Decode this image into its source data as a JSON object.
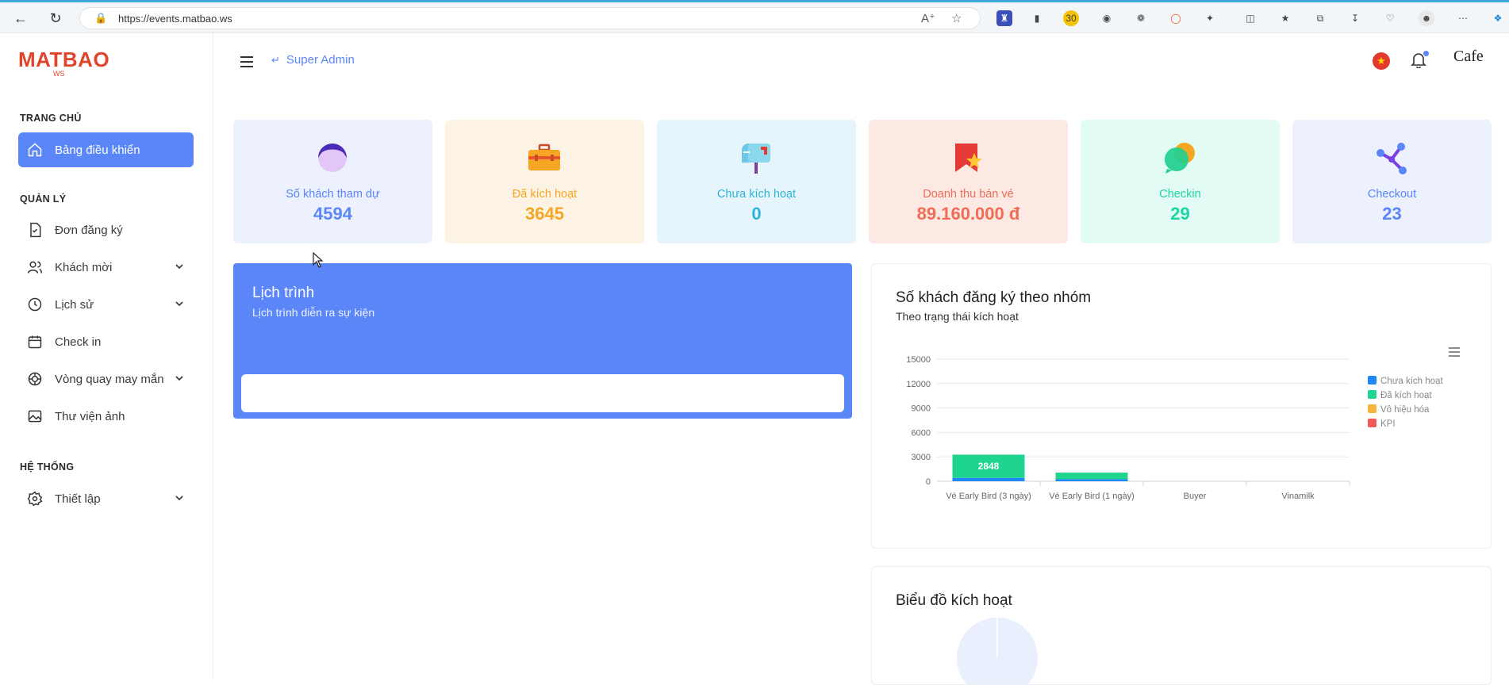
{
  "browser": {
    "url": "https://events.matbao.ws"
  },
  "sidebar": {
    "logo_main": "MATBAO",
    "logo_sub": "WS",
    "sections": [
      {
        "label": "TRANG CHỦ"
      },
      {
        "label": "QUẢN LÝ"
      },
      {
        "label": "HỆ THỐNG"
      }
    ],
    "items": [
      {
        "label": "Bảng điều khiển",
        "icon": "home-icon",
        "active": true
      },
      {
        "label": "Đơn đăng ký",
        "icon": "document-icon"
      },
      {
        "label": "Khách mời",
        "icon": "users-icon"
      },
      {
        "label": "Lịch sử",
        "icon": "clock-icon"
      },
      {
        "label": "Check in",
        "icon": "calendar-icon"
      },
      {
        "label": "Vòng quay may mắn",
        "icon": "wheel-icon"
      },
      {
        "label": "Thư viện ảnh",
        "icon": "image-icon"
      },
      {
        "label": "Thiết lập",
        "icon": "gear-icon"
      }
    ]
  },
  "header": {
    "back_label": "Super Admin",
    "avatar_text": "Cafe"
  },
  "stats": [
    {
      "label": "Số khách tham dự",
      "value": "4594",
      "color": "#5b86f7",
      "bg": "#ecf1fd"
    },
    {
      "label": "Đã kích hoạt",
      "value": "3645",
      "color": "#f5a623",
      "bg": "#fdf3e4"
    },
    {
      "label": "Chưa kích hoạt",
      "value": "0",
      "color": "#2ab4d8",
      "bg": "#e6f5fb"
    },
    {
      "label": "Doanh thu bán vé",
      "value": "89.160.000 đ",
      "color": "#ef6c55",
      "bg": "#fde9e4"
    },
    {
      "label": "Checkin",
      "value": "29",
      "color": "#1fd4a5",
      "bg": "#e2fbf4"
    },
    {
      "label": "Checkout",
      "value": "23",
      "color": "#5b86f7",
      "bg": "#ecf1fd"
    }
  ],
  "schedule": {
    "title": "Lịch trình",
    "subtitle": "Lịch trình diễn ra sự kiện"
  },
  "chart_card": {
    "title": "Số khách đăng ký theo nhóm",
    "subtitle": "Theo trạng thái kích hoạt"
  },
  "chart_data": {
    "type": "bar",
    "categories": [
      "Vé Early Bird (3 ngày)",
      "Vé Early Bird (1 ngày)",
      "Buyer",
      "Vinamilk"
    ],
    "series": [
      {
        "name": "Chưa kích hoạt",
        "color": "#1e88f5",
        "values": [
          420,
          260,
          0,
          0
        ]
      },
      {
        "name": "Đã kích hoạt",
        "color": "#1fd48f",
        "values": [
          2848,
          797,
          0,
          0
        ]
      },
      {
        "name": "Vô hiệu hóa",
        "color": "#f5b73b",
        "values": [
          0,
          0,
          0,
          0
        ]
      },
      {
        "name": "KPI",
        "color": "#ee5a5a",
        "values": [
          0,
          0,
          0,
          0
        ]
      }
    ],
    "data_labels": [
      {
        "category": "Vé Early Bird (3 ngày)",
        "text": "2848"
      }
    ],
    "yticks": [
      "0",
      "3000",
      "6000",
      "9000",
      "12000",
      "15000"
    ],
    "ylim": [
      0,
      15000
    ],
    "stacked": true,
    "legend": "right"
  },
  "activation_card": {
    "title": "Biểu đồ kích hoạt"
  }
}
